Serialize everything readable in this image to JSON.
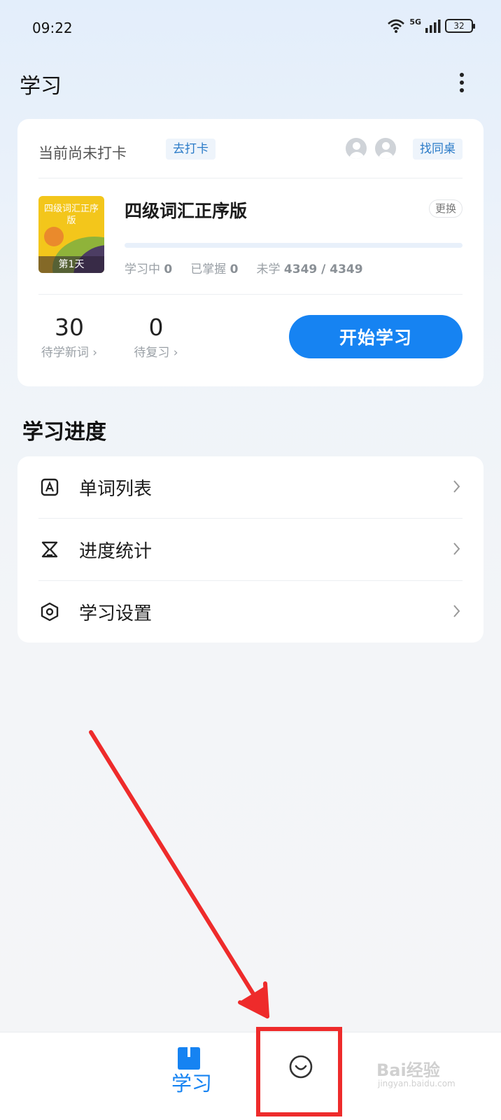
{
  "status_bar": {
    "time": "09:22",
    "network": "5G",
    "battery": "32"
  },
  "header": {
    "title": "学习",
    "more_icon": "more-vertical-icon"
  },
  "study_card": {
    "checkin_status": "当前尚未打卡",
    "checkin_button": "去打卡",
    "find_deskmate_button": "找同桌",
    "book": {
      "cover_title": "四级词汇正序版",
      "cover_day": "第1天",
      "title": "四级词汇正序版",
      "change_button": "更换",
      "progress": 0,
      "learning_label": "学习中",
      "learning_count": "0",
      "mastered_label": "已掌握",
      "mastered_count": "0",
      "unlearned_label": "未学",
      "unlearned_count": "4349 / 4349"
    },
    "new_words": {
      "count": "30",
      "label": "待学新词 ›"
    },
    "review": {
      "count": "0",
      "label": "待复习 ›"
    },
    "start_button": "开始学习"
  },
  "progress_section": {
    "title": "学习进度",
    "items": [
      {
        "label": "单词列表",
        "icon": "word-list-icon"
      },
      {
        "label": "进度统计",
        "icon": "hourglass-icon"
      },
      {
        "label": "学习设置",
        "icon": "settings-hexagon-icon"
      }
    ]
  },
  "tab_bar": {
    "tabs": [
      {
        "label": "学习",
        "icon": "book-icon",
        "active": true
      },
      {
        "label": "",
        "icon": "smile-icon",
        "active": false
      }
    ]
  },
  "watermark": {
    "text": "Bai经验",
    "sub": "jingyan.baidu.com"
  },
  "colors": {
    "accent": "#1683f2",
    "annotation": "#ee2b2b"
  }
}
